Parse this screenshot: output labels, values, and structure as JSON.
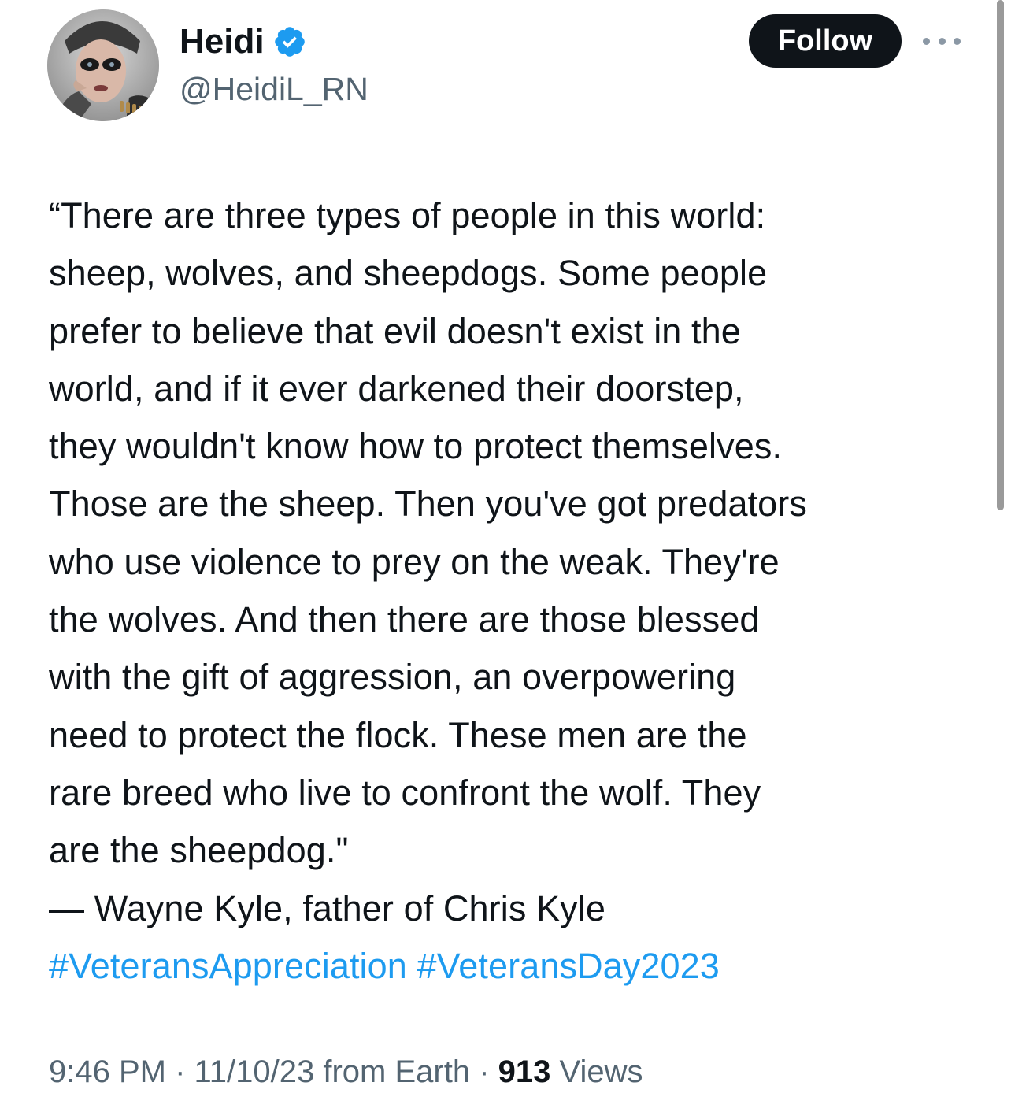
{
  "author": {
    "display_name": "Heidi",
    "handle": "@HeidiL_RN",
    "verified": true,
    "verified_icon": "verified-badge-icon",
    "avatar_icon": "avatar"
  },
  "actions": {
    "follow_label": "Follow",
    "more_icon": "more-options-icon"
  },
  "tweet": {
    "lines": [
      "“There are three types of people in this world:",
      "sheep, wolves, and sheepdogs. Some people",
      "prefer to believe that evil doesn't exist in the",
      "world, and if it ever darkened their doorstep,",
      "they wouldn't know how to protect themselves.",
      "Those are the sheep. Then you've got predators",
      "who use violence to prey on the weak. They're",
      "the wolves. And then there are those blessed",
      "with the gift of aggression, an overpowering",
      "need to protect the flock. These men are the",
      "rare breed who live to confront the wolf. They",
      "are the sheepdog.\"",
      "― Wayne Kyle, father of Chris Kyle"
    ],
    "hashtags": [
      "#VeteransAppreciation",
      "#VeteransDay2023"
    ]
  },
  "meta": {
    "time": "9:46 PM",
    "separator": " · ",
    "date": "11/10/23",
    "source": " from Earth",
    "views_count": "913",
    "views_label": " Views"
  },
  "colors": {
    "text": "#0f1419",
    "secondary": "#536471",
    "link": "#1d9bf0",
    "follow_bg": "#0f1419",
    "verified": "#1d9bf0"
  }
}
